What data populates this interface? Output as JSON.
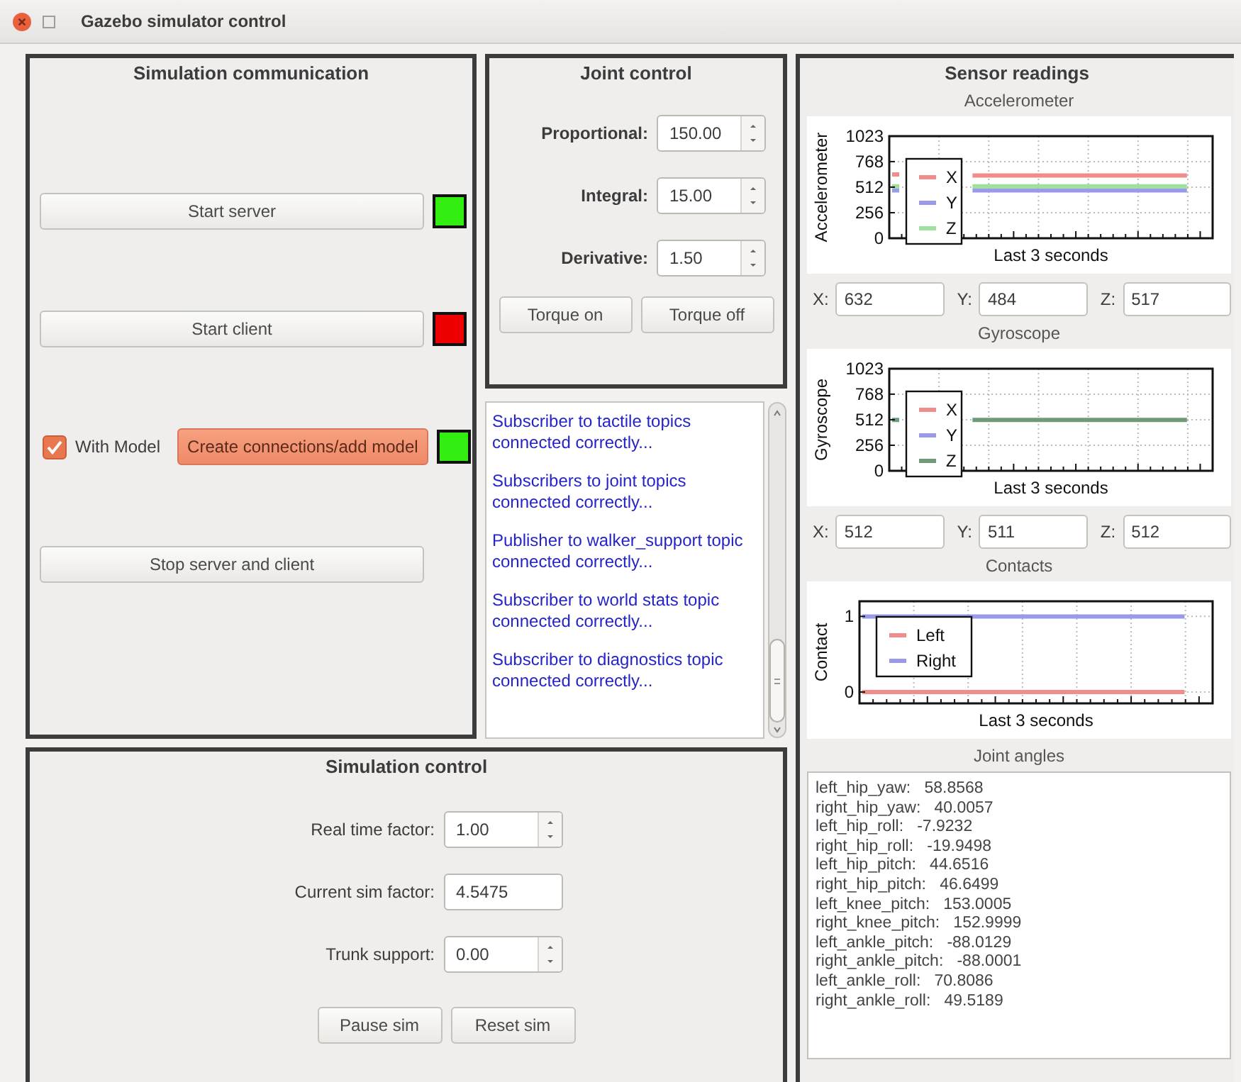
{
  "window": {
    "title": "Gazebo simulator control"
  },
  "communication": {
    "title": "Simulation communication",
    "rows": [
      {
        "kind": "button",
        "label": "Start server",
        "color": "#33ee11",
        "focused": false
      },
      {
        "kind": "button",
        "label": "Start client",
        "color": "#ee0000",
        "focused": false
      },
      {
        "kind": "model",
        "checkbox": {
          "label": "With Model",
          "checked": true
        },
        "label": "Create connections/add model",
        "color": "#33ee11",
        "focused": true
      },
      {
        "kind": "button",
        "label": "Stop server and client",
        "focused": false
      }
    ]
  },
  "joint_control": {
    "title": "Joint control",
    "fields": [
      {
        "label": "Proportional:",
        "value": "150.00"
      },
      {
        "label": "Integral:",
        "value": "15.00"
      },
      {
        "label": "Derivative:",
        "value": "1.50"
      }
    ],
    "buttons": [
      "Torque on",
      "Torque off"
    ]
  },
  "log": {
    "messages": [
      "Subscriber to tactile topics connected correctly...",
      "Subscribers to joint topics connected correctly...",
      "Publisher to walker_support topic connected correctly...",
      "Subscriber to world stats topic connected correctly...",
      "Subscriber to diagnostics topic connected correctly..."
    ]
  },
  "simulation_control": {
    "title": "Simulation control",
    "fields": [
      {
        "kind": "spin",
        "label": "Real time factor:",
        "value": "1.00"
      },
      {
        "kind": "text",
        "label": "Current sim factor:",
        "value": "4.5475"
      },
      {
        "kind": "spin",
        "label": "Trunk support:",
        "value": "0.00"
      }
    ],
    "buttons": [
      "Pause sim",
      "Reset sim"
    ]
  },
  "sensors": {
    "title": "Sensor readings",
    "charts": [
      {
        "title": "Accelerometer",
        "chart_data": {
          "type": "line",
          "xlabel": "Last 3 seconds",
          "ylabel": "Accelerometer",
          "ylim": [
            0,
            1023
          ],
          "yticks": [
            0,
            256,
            512,
            768,
            1023
          ],
          "grid": true,
          "legend": "lower left",
          "series": [
            {
              "name": "X",
              "color": "#f08c8c",
              "values": [
                640,
                null,
                null,
                630,
                630,
                630,
                630,
                630,
                630,
                630,
                630,
                630
              ]
            },
            {
              "name": "Y",
              "color": "#9a9ae8",
              "values": [
                480,
                null,
                null,
                480,
                480,
                480,
                480,
                480,
                480,
                480,
                480,
                480
              ]
            },
            {
              "name": "Z",
              "color": "#9ee09e",
              "values": [
                520,
                null,
                null,
                520,
                520,
                520,
                520,
                520,
                520,
                520,
                520,
                520
              ]
            }
          ]
        },
        "readings": [
          {
            "label": "X:",
            "value": "632"
          },
          {
            "label": "Y:",
            "value": "484"
          },
          {
            "label": "Z:",
            "value": "517"
          }
        ]
      },
      {
        "title": "Gyroscope",
        "chart_data": {
          "type": "line",
          "xlabel": "Last 3 seconds",
          "ylabel": "Gyroscope",
          "ylim": [
            0,
            1023
          ],
          "yticks": [
            0,
            256,
            512,
            768,
            1023
          ],
          "grid": true,
          "legend": "lower left",
          "series": [
            {
              "name": "X",
              "color": "#f08c8c",
              "values": [
                null,
                null,
                null,
                null,
                null,
                null,
                null,
                null,
                null,
                null,
                null,
                null
              ]
            },
            {
              "name": "Y",
              "color": "#9a9ae8",
              "values": [
                null,
                null,
                null,
                null,
                null,
                null,
                null,
                null,
                null,
                null,
                null,
                null
              ]
            },
            {
              "name": "Z",
              "color": "#6f9a78",
              "values": [
                510,
                null,
                null,
                510,
                510,
                510,
                510,
                510,
                510,
                510,
                510,
                510
              ]
            }
          ]
        },
        "readings": [
          {
            "label": "X:",
            "value": "512"
          },
          {
            "label": "Y:",
            "value": "511"
          },
          {
            "label": "Z:",
            "value": "512"
          }
        ]
      },
      {
        "title": "Contacts",
        "chart_data": {
          "type": "line",
          "xlabel": "Last 3 seconds",
          "ylabel": "Contact",
          "ylim": [
            -0.15,
            1.2
          ],
          "yticks": [
            0,
            1
          ],
          "grid": true,
          "legend": "center left",
          "series": [
            {
              "name": "Left",
              "color": "#f08c8c",
              "values": [
                0,
                0,
                0,
                0,
                0,
                0,
                0,
                0,
                0,
                0,
                0,
                0
              ]
            },
            {
              "name": "Right",
              "color": "#9a9ae8",
              "values": [
                1,
                1,
                1,
                1,
                1,
                1,
                1,
                1,
                1,
                1,
                1,
                1
              ]
            }
          ]
        }
      }
    ],
    "joint_angles": {
      "title": "Joint angles",
      "lines": [
        {
          "name": "left_hip_yaw:",
          "value": "58.8568"
        },
        {
          "name": "right_hip_yaw:",
          "value": "40.0057"
        },
        {
          "name": "left_hip_roll:",
          "value": "-7.9232"
        },
        {
          "name": "right_hip_roll:",
          "value": "-19.9498"
        },
        {
          "name": "left_hip_pitch:",
          "value": "44.6516"
        },
        {
          "name": "right_hip_pitch:",
          "value": "46.6499"
        },
        {
          "name": "left_knee_pitch:",
          "value": "153.0005"
        },
        {
          "name": "right_knee_pitch:",
          "value": "152.9999"
        },
        {
          "name": "left_ankle_pitch:",
          "value": "-88.0129"
        },
        {
          "name": "right_ankle_pitch:",
          "value": "-88.0001"
        },
        {
          "name": "left_ankle_roll:",
          "value": "70.8086"
        },
        {
          "name": "right_ankle_roll:",
          "value": "49.5189"
        }
      ]
    }
  }
}
